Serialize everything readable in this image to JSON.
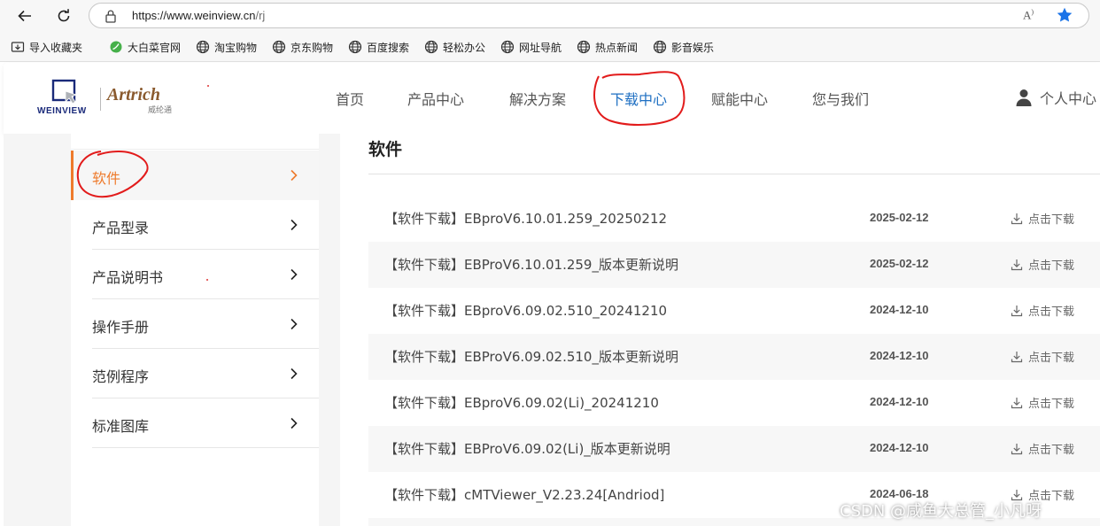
{
  "browser": {
    "url_main": "https://www.weinview.cn",
    "url_path": "/rj",
    "read_aloud_glyph": "A",
    "bookmarks": [
      {
        "label": "导入收藏夹",
        "icon": "import-icon"
      },
      {
        "label": "大白菜官网",
        "icon": "leaf-icon"
      },
      {
        "label": "淘宝购物",
        "icon": "globe-icon"
      },
      {
        "label": "京东购物",
        "icon": "globe-icon"
      },
      {
        "label": "百度搜索",
        "icon": "globe-icon"
      },
      {
        "label": "轻松办公",
        "icon": "globe-icon"
      },
      {
        "label": "网址导航",
        "icon": "globe-icon"
      },
      {
        "label": "热点新闻",
        "icon": "globe-icon"
      },
      {
        "label": "影音娱乐",
        "icon": "globe-icon"
      }
    ]
  },
  "site": {
    "logo_weinview": "WEINVIEW",
    "logo_artrich": "Artrich",
    "logo_artrich_sub": "威纶通",
    "nav": [
      "首页",
      "产品中心",
      "解决方案",
      "下载中心",
      "赋能中心",
      "您与我们"
    ],
    "active_nav": "下载中心",
    "user_label": "个人中心",
    "accent_color": "#ee7a2b",
    "link_color": "#1e6fc2"
  },
  "sidebar": {
    "items": [
      {
        "label": "软件",
        "active": true
      },
      {
        "label": "产品型录",
        "active": false
      },
      {
        "label": "产品说明书",
        "active": false
      },
      {
        "label": "操作手册",
        "active": false
      },
      {
        "label": "范例程序",
        "active": false
      },
      {
        "label": "标准图库",
        "active": false
      }
    ]
  },
  "content": {
    "title": "软件",
    "download_label": "点击下载",
    "rows": [
      {
        "title": "【软件下载】EBproV6.10.01.259_20250212",
        "date": "2025-02-12"
      },
      {
        "title": "【软件下载】EBProV6.10.01.259_版本更新说明",
        "date": "2025-02-12"
      },
      {
        "title": "【软件下载】EBproV6.09.02.510_20241210",
        "date": "2024-12-10"
      },
      {
        "title": "【软件下载】EBProV6.09.02.510_版本更新说明",
        "date": "2024-12-10"
      },
      {
        "title": "【软件下载】EBproV6.09.02(Li)_20241210",
        "date": "2024-12-10"
      },
      {
        "title": "【软件下载】EBProV6.09.02(Li)_版本更新说明",
        "date": "2024-12-10"
      },
      {
        "title": "【软件下载】cMTViewer_V2.23.24[Andriod]",
        "date": "2024-06-18"
      }
    ]
  },
  "watermark": "CSDN @咸鱼大总管_小凡呀"
}
